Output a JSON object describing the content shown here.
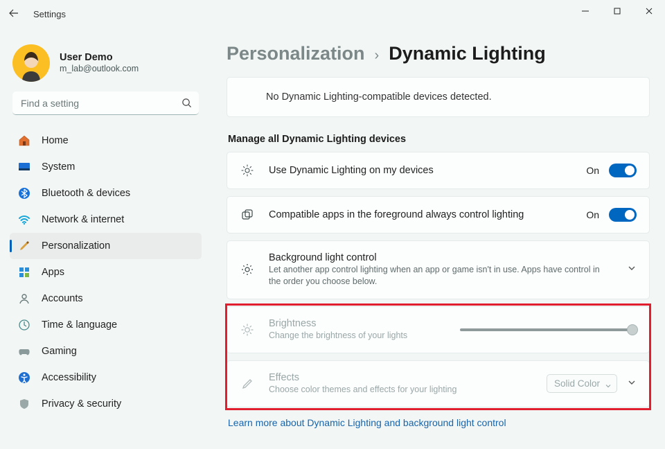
{
  "window": {
    "title": "Settings"
  },
  "account": {
    "name": "User Demo",
    "email": "m_lab@outlook.com"
  },
  "search": {
    "placeholder": "Find a setting"
  },
  "nav": [
    {
      "key": "home",
      "label": "Home"
    },
    {
      "key": "system",
      "label": "System"
    },
    {
      "key": "bluetooth",
      "label": "Bluetooth & devices"
    },
    {
      "key": "network",
      "label": "Network & internet"
    },
    {
      "key": "personalization",
      "label": "Personalization",
      "selected": true
    },
    {
      "key": "apps",
      "label": "Apps"
    },
    {
      "key": "accounts",
      "label": "Accounts"
    },
    {
      "key": "time",
      "label": "Time & language"
    },
    {
      "key": "gaming",
      "label": "Gaming"
    },
    {
      "key": "accessibility",
      "label": "Accessibility"
    },
    {
      "key": "privacy",
      "label": "Privacy & security"
    }
  ],
  "breadcrumb": {
    "parent": "Personalization",
    "current": "Dynamic Lighting"
  },
  "notice": "No Dynamic Lighting-compatible devices detected.",
  "groupTitle": "Manage all Dynamic Lighting devices",
  "rows": {
    "use": {
      "title": "Use Dynamic Lighting on my devices",
      "state": "On"
    },
    "compat": {
      "title": "Compatible apps in the foreground always control lighting",
      "state": "On"
    },
    "bg": {
      "title": "Background light control",
      "sub": "Let another app control lighting when an app or game isn't in use. Apps have control in the order you choose below."
    },
    "brightness": {
      "title": "Brightness",
      "sub": "Change the brightness of your lights",
      "value": 100
    },
    "effects": {
      "title": "Effects",
      "sub": "Choose color themes and effects for your lighting",
      "selected": "Solid Color"
    }
  },
  "learnMore": "Learn more about Dynamic Lighting and background light control"
}
